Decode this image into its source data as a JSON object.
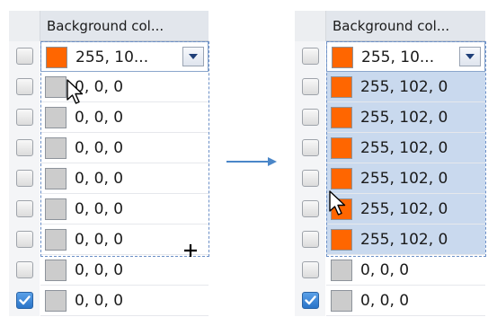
{
  "header": {
    "title": "Background col..."
  },
  "left": {
    "editor": {
      "value": "255, 10...",
      "color": "#ff6600"
    },
    "rows": [
      {
        "value": "0, 0, 0",
        "color": "#cccccc",
        "checked": false
      },
      {
        "value": "0, 0, 0",
        "color": "#cccccc",
        "checked": false
      },
      {
        "value": "0, 0, 0",
        "color": "#cccccc",
        "checked": false
      },
      {
        "value": "0, 0, 0",
        "color": "#cccccc",
        "checked": false
      },
      {
        "value": "0, 0, 0",
        "color": "#cccccc",
        "checked": false
      },
      {
        "value": "0, 0, 0",
        "color": "#cccccc",
        "checked": false
      },
      {
        "value": "0, 0, 0",
        "color": "#cccccc",
        "checked": false
      },
      {
        "value": "0, 0, 0",
        "color": "#cccccc",
        "checked": true
      }
    ]
  },
  "right": {
    "editor": {
      "value": "255, 10...",
      "color": "#ff6600"
    },
    "rows": [
      {
        "value": "255, 102, 0",
        "color": "#ff6600",
        "checked": false,
        "selected": true
      },
      {
        "value": "255, 102, 0",
        "color": "#ff6600",
        "checked": false,
        "selected": true
      },
      {
        "value": "255, 102, 0",
        "color": "#ff6600",
        "checked": false,
        "selected": true
      },
      {
        "value": "255, 102, 0",
        "color": "#ff6600",
        "checked": false,
        "selected": true
      },
      {
        "value": "255, 102, 0",
        "color": "#ff6600",
        "checked": false,
        "selected": true
      },
      {
        "value": "255, 102, 0",
        "color": "#ff6600",
        "checked": false,
        "selected": true
      },
      {
        "value": "0, 0, 0",
        "color": "#cccccc",
        "checked": false,
        "selected": false
      },
      {
        "value": "0, 0, 0",
        "color": "#cccccc",
        "checked": true,
        "selected": false
      }
    ]
  },
  "icons": {
    "transition_arrow": "right-arrow-icon",
    "pointer": "mouse-pointer-icon",
    "crosshair": "crosshair-cursor-icon",
    "dropdown": "chevron-down-icon",
    "check": "checkmark-icon"
  },
  "colors": {
    "accent_orange": "#ff6600",
    "default_gray": "#cccccc",
    "selection_blue": "#c9d9ee",
    "arrow_blue": "#4a86c8"
  }
}
